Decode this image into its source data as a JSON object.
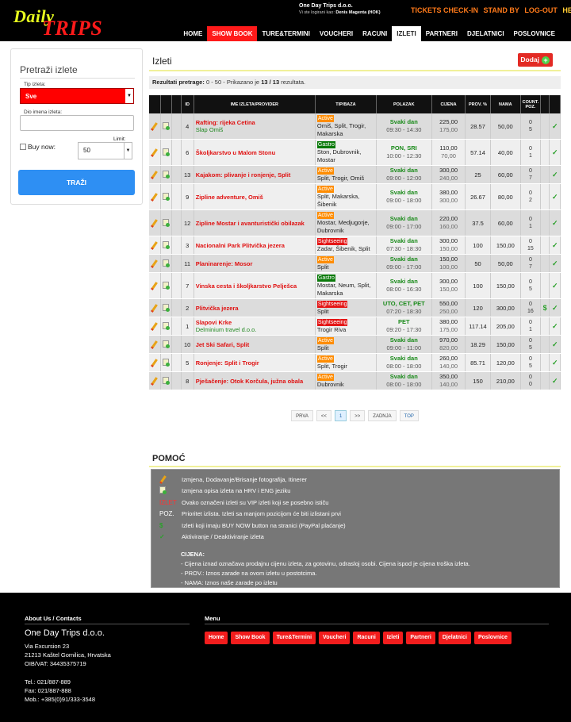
{
  "header": {
    "logo_top": "Daily",
    "logo_bottom": "TRIPS",
    "company": "One Day Trips d.o.o.",
    "logged_in_prefix": "Vi ste logirani kao:",
    "logged_in_user": "Denis Magenta (HOK)",
    "links": [
      "TICKETS CHECK-IN",
      "STAND BY",
      "LOG-OUT",
      "HELP"
    ],
    "nav": [
      "HOME",
      "SHOW BOOK",
      "TURE&TERMINI",
      "VOUCHERI",
      "RACUNI",
      "IZLETI",
      "PARTNERI",
      "DJELATNICI",
      "POSLOVNICE"
    ],
    "nav_selected": "IZLETI",
    "nav_highlight": "SHOW BOOK"
  },
  "search": {
    "title": "Pretraži izlete",
    "tip_label": "Tip izleta:",
    "tip_value": "Sve",
    "name_label": "Dio imena izleta:",
    "name_value": "",
    "buy_now_label": "Buy now:",
    "limit_label": "Limit:",
    "limit_value": "50",
    "submit": "TRAŽI"
  },
  "list": {
    "title": "Izleti",
    "add_button": "Dodaj",
    "results_prefix": "Rezultati pretrage:",
    "results_range": "0 - 50",
    "results_middle": "- Prikazano je",
    "results_count": "13 / 13",
    "results_suffix": "rezultata.",
    "columns": [
      "",
      "",
      "",
      "ID",
      "IME IZLETA/PROVIDER",
      "TIP/BAZA",
      "POLAZAK",
      "CIJENA",
      "PROV. %",
      "NAMA",
      "COUNT. POZ.",
      "",
      ""
    ],
    "rows": [
      {
        "id": "4",
        "name": "Rafting: rijeka Cetina",
        "provider": "Slap Omiš",
        "tag": "Active",
        "base": "Omiš, Split, Trogir, Makarska",
        "day": "Svaki dan",
        "time": "09:30 - 14:30",
        "p1": "225,00",
        "p2": "175,00",
        "prov": "28.57",
        "nama": "50,00",
        "c1": "0",
        "c2": "5",
        "dollar": ""
      },
      {
        "id": "6",
        "name": "Školjkarstvo u Malom Stonu",
        "provider": "",
        "tag": "Gastro",
        "base": "Ston, Dubrovnik, Mostar",
        "day": "PON, SRI",
        "time": "10:00 - 12:30",
        "p1": "110,00",
        "p2": "70,00",
        "prov": "57.14",
        "nama": "40,00",
        "c1": "0",
        "c2": "1",
        "dollar": ""
      },
      {
        "id": "13",
        "name": "Kajakom: plivanje i ronjenje, Split",
        "provider": "",
        "tag": "Active",
        "base": "Split, Trogir, Omiš",
        "day": "Svaki dan",
        "time": "09:00 - 12:00",
        "p1": "300,00",
        "p2": "240,00",
        "prov": "25",
        "nama": "60,00",
        "c1": "0",
        "c2": "7",
        "dollar": ""
      },
      {
        "id": "9",
        "name": "Zipline adventure, Omiš",
        "provider": "",
        "tag": "Active",
        "base": "Split, Makarska, Šibenik",
        "day": "Svaki dan",
        "time": "09:00 - 18:00",
        "p1": "380,00",
        "p2": "300,00",
        "prov": "26.67",
        "nama": "80,00",
        "c1": "0",
        "c2": "2",
        "dollar": ""
      },
      {
        "id": "12",
        "name": "Zipline Mostar i avanturistički obilazak",
        "provider": "",
        "tag": "Active",
        "base": "Mostar, Medjugorje, Dubrovnik",
        "day": "Svaki dan",
        "time": "09:00 - 17:00",
        "p1": "220,00",
        "p2": "160,00",
        "prov": "37.5",
        "nama": "60,00",
        "c1": "0",
        "c2": "1",
        "dollar": ""
      },
      {
        "id": "3",
        "name": "Nacionalni Park Plitvička jezera",
        "provider": "",
        "tag": "Sightseeing",
        "base": "Zadar, Šibenik, Split",
        "day": "Svaki dan",
        "time": "07:30 - 18:30",
        "p1": "300,00",
        "p2": "150,00",
        "prov": "100",
        "nama": "150,00",
        "c1": "0",
        "c2": "15",
        "dollar": ""
      },
      {
        "id": "11",
        "name": "Planinarenje: Mosor",
        "provider": "",
        "tag": "Active",
        "base": "Split",
        "day": "Svaki dan",
        "time": "09:00 - 17:00",
        "p1": "150,00",
        "p2": "100,00",
        "prov": "50",
        "nama": "50,00",
        "c1": "0",
        "c2": "7",
        "dollar": ""
      },
      {
        "id": "7",
        "name": "Vinska cesta i školjkarstvo Pelješca",
        "provider": "",
        "tag": "Gastro",
        "base": "Mostar, Neum, Split, Makarska",
        "day": "Svaki dan",
        "time": "08:00 - 16:30",
        "p1": "300,00",
        "p2": "150,00",
        "prov": "100",
        "nama": "150,00",
        "c1": "0",
        "c2": "5",
        "dollar": ""
      },
      {
        "id": "2",
        "name": "Plitvička jezera",
        "provider": "",
        "tag": "Sightseeing",
        "base": "Split",
        "day": "UTO, CET, PET",
        "time": "07:20 - 18:30",
        "p1": "550,00",
        "p2": "250,00",
        "prov": "120",
        "nama": "300,00",
        "c1": "0",
        "c2": "16",
        "dollar": "$"
      },
      {
        "id": "1",
        "name": "Slapovi Krke",
        "provider": "Delminium travel d.o.o.",
        "tag": "Sightseeing",
        "base": "Trogir Riva",
        "day": "PET",
        "time": "09:20 - 17:30",
        "p1": "380,00",
        "p2": "175,00",
        "prov": "117.14",
        "nama": "205,00",
        "c1": "0",
        "c2": "1",
        "dollar": ""
      },
      {
        "id": "10",
        "name": "Jet Ski Safari, Split",
        "provider": "",
        "tag": "Active",
        "base": "Split",
        "day": "Svaki dan",
        "time": "09:00 - 11:00",
        "p1": "970,00",
        "p2": "820,00",
        "prov": "18.29",
        "nama": "150,00",
        "c1": "0",
        "c2": "5",
        "dollar": ""
      },
      {
        "id": "5",
        "name": "Ronjenje: Split i Trogir",
        "provider": "",
        "tag": "Active",
        "base": "Split, Trogir",
        "day": "Svaki dan",
        "time": "08:00 - 18:00",
        "p1": "260,00",
        "p2": "140,00",
        "prov": "85.71",
        "nama": "120,00",
        "c1": "0",
        "c2": "5",
        "dollar": ""
      },
      {
        "id": "8",
        "name": "Pješačenje: Otok Korčula, južna obala",
        "provider": "",
        "tag": "Active",
        "base": "Dubrovnik",
        "day": "Svaki dan",
        "time": "08:00 - 18:00",
        "p1": "350,00",
        "p2": "140,00",
        "prov": "150",
        "nama": "210,00",
        "c1": "0",
        "c2": "0",
        "dollar": ""
      }
    ],
    "pagination": [
      "PRVA",
      "<<",
      "1",
      ">>",
      "ZADNJA",
      "TOP"
    ],
    "current_page": "1"
  },
  "help": {
    "title": "POMOĆ",
    "items": [
      {
        "key": "",
        "icon": "pencil-icon",
        "text": "Izmjena, Dodavanje/Brisanje fotografija, Itinerer"
      },
      {
        "key": "",
        "icon": "document-icon",
        "text": "Izmjena opisa izleta na HRV i ENG jeziku"
      },
      {
        "key": "IZLET",
        "icon": "",
        "text": "Ovako označeni izleti su VIP izleti koji se posebno ističu"
      },
      {
        "key": "POZ.",
        "icon": "",
        "text": "Prioritet izlista. Izleti sa manjom pozicijom će biti izlistani prvi"
      },
      {
        "key": "$",
        "icon": "dollar-icon",
        "text": "Izleti koji imaju BUY NOW button na stranici (PayPal plaćanje)"
      },
      {
        "key": "✓",
        "icon": "check-icon",
        "text": "Aktiviranje / Deaktiviranje izleta"
      }
    ],
    "cijena_title": "CIJENA:",
    "cijena_lines": [
      "- Cijena iznad označava prodajnu cijenu izleta, za gotovinu, odrasloj osobi. Cijena ispod je cijena troška izleta.",
      "- PROV.: Iznos zarade na ovom izletu u postotcima.",
      "- NAMA: Iznos naše zarade po izletu"
    ]
  },
  "footer": {
    "about_title": "About Us / Contacts",
    "menu_title": "Menu",
    "company": "One Day Trips d.o.o.",
    "address": [
      "Via Excursion 23",
      "21213 Kaštel Gomilica, Hrvatska",
      "OIB/VAT: 34435375719"
    ],
    "phones": [
      "Tel.: 021/887-889",
      "Fax: 021/887-888",
      "Mob.: +385(0)91/333-3548"
    ],
    "menu": [
      "Home",
      "Show Book",
      "Ture&Termini",
      "Voucheri",
      "Racuni",
      "Izleti",
      "Partneri",
      "Djelatnici",
      "Poslovnice"
    ]
  },
  "colors": {
    "accent_red": "#ff1a1a",
    "active_tag": "#ff8c00",
    "gastro_tag": "#0a7a0a",
    "sight_tag": "#e41616",
    "button_blue": "#2e8ff3"
  }
}
